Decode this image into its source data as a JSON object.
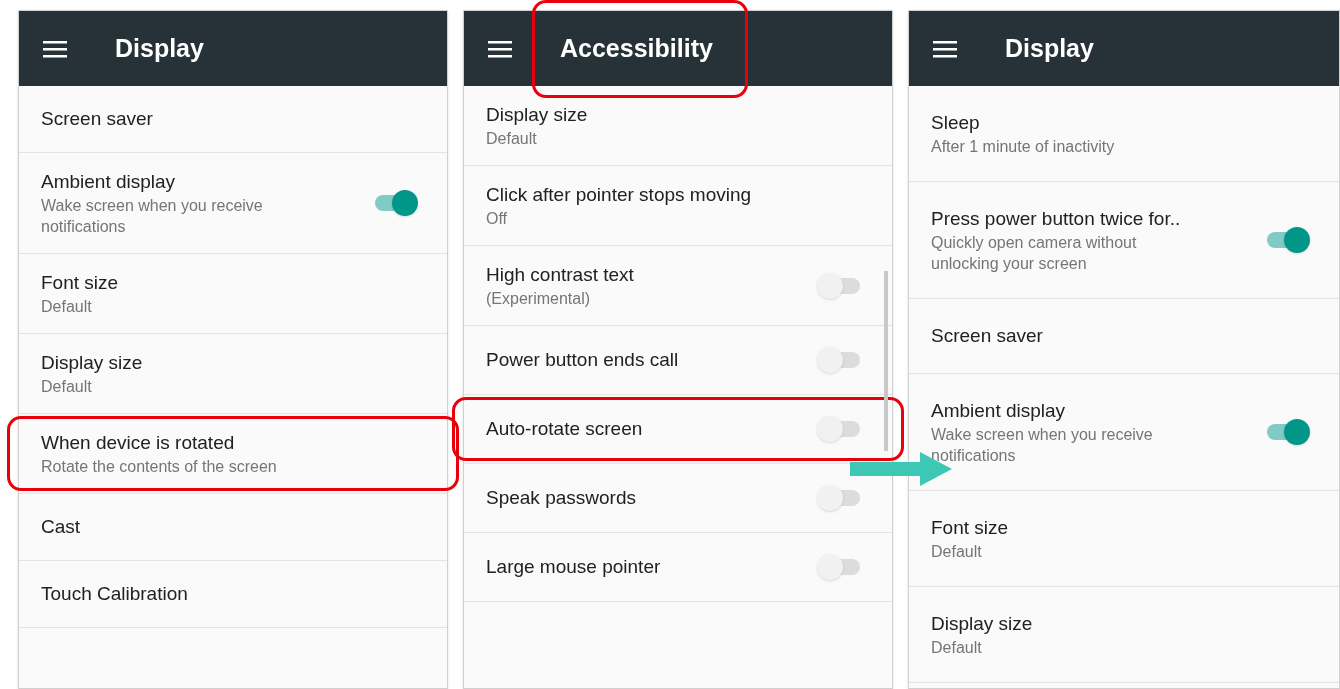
{
  "panels": [
    {
      "title": "Display",
      "items": [
        {
          "title": "Screen saver"
        },
        {
          "title": "Ambient display",
          "summary": "Wake screen when you receive notifications",
          "switch": {
            "on": true
          }
        },
        {
          "title": "Font size",
          "summary": "Default"
        },
        {
          "title": "Display size",
          "summary": "Default"
        },
        {
          "title": "When device is rotated",
          "summary": "Rotate the contents of the screen",
          "highlighted": true
        },
        {
          "title": "Cast"
        },
        {
          "title": "Touch Calibration"
        }
      ]
    },
    {
      "title": "Accessibility",
      "title_highlighted": true,
      "scrollbar": true,
      "items": [
        {
          "title": "Display size",
          "summary": "Default"
        },
        {
          "title": "Click after pointer stops moving",
          "summary": "Off"
        },
        {
          "title": "High contrast text",
          "summary": "(Experimental)",
          "switch": {
            "on": false
          }
        },
        {
          "title": "Power button ends call",
          "switch": {
            "on": false
          }
        },
        {
          "title": "Auto-rotate screen",
          "switch": {
            "on": false
          },
          "highlighted": true
        },
        {
          "title": "Speak passwords",
          "switch": {
            "on": false
          }
        },
        {
          "title": "Large mouse pointer",
          "switch": {
            "on": false
          }
        }
      ]
    },
    {
      "title": "Display",
      "items": [
        {
          "title": "Sleep",
          "summary": "After 1 minute of inactivity"
        },
        {
          "title": "Press power button twice for..",
          "summary": "Quickly open camera without unlocking your screen",
          "switch": {
            "on": true
          }
        },
        {
          "title": "Screen saver"
        },
        {
          "title": "Ambient display",
          "summary": "Wake screen when you receive notifications",
          "switch": {
            "on": true
          }
        },
        {
          "title": "Font size",
          "summary": "Default"
        },
        {
          "title": "Display size",
          "summary": "Default"
        }
      ]
    }
  ]
}
